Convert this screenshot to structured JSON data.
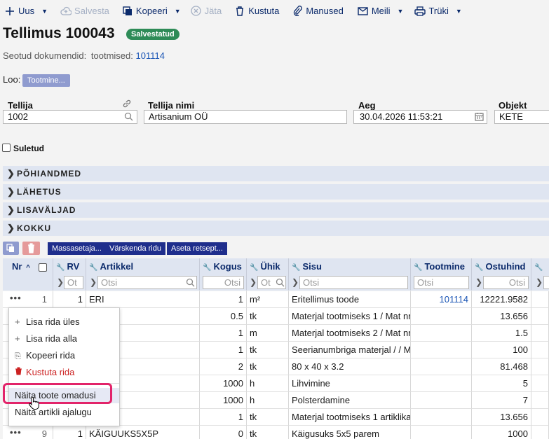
{
  "toolbar": {
    "new": "Uus",
    "save": "Salvesta",
    "copy": "Kopeeri",
    "skip": "Jäta",
    "delete": "Kustuta",
    "attachments": "Manused",
    "email": "Meili",
    "print": "Trüki"
  },
  "header": {
    "title": "Tellimus 100043",
    "status": "Salvestatud",
    "linked_label": "Seotud dokumendid:",
    "linked_type": "tootmised:",
    "linked_id": "101114",
    "loo_label": "Loo:",
    "loo_button": "Tootmine..."
  },
  "fields": {
    "customer_label": "Tellija",
    "customer_value": "1002",
    "name_label": "Tellija nimi",
    "name_value": "Artisanium OÜ",
    "time_label": "Aeg",
    "time_value": "30.04.2026 11:53:21",
    "object_label": "Objekt",
    "object_value": "KETE"
  },
  "closed_label": "Suletud",
  "sections": [
    "PÕHIANDMED",
    "LÄHETUS",
    "LISAVÄLJAD",
    "KOKKU"
  ],
  "row_buttons": [
    "Massasetaja...",
    "Värskenda ridu",
    "Aseta retsept..."
  ],
  "columns": {
    "nr": "Nr",
    "rv": "RV",
    "artikkel": "Artikkel",
    "kogus": "Kogus",
    "uhik": "Ühik",
    "sisu": "Sisu",
    "tootmine": "Tootmine",
    "ostuhind": "Ostuhind"
  },
  "filters": {
    "rv": "Ot",
    "artikkel": "Otsi",
    "kogus": "Otsi",
    "uhik": "Ot",
    "sisu": "Otsi",
    "tootmine": "Otsi",
    "ostuhind": "Otsi"
  },
  "rows": [
    {
      "nr": "1",
      "rv": "1",
      "artikkel": "ERI",
      "kogus": "1",
      "uhik": "m²",
      "sisu": "Eritellimus toode",
      "tootmine": "101114",
      "ostuhind": "12221.9582"
    },
    {
      "nr": "",
      "rv": "",
      "artikkel": "",
      "kogus": "0.5",
      "uhik": "tk",
      "sisu": "Materjal tootmiseks 1 / Mat nr",
      "tootmine": "",
      "ostuhind": "13.656"
    },
    {
      "nr": "",
      "rv": "",
      "artikkel": "",
      "kogus": "1",
      "uhik": "m",
      "sisu": "Materjal tootmiseks 2 / Mat nr",
      "tootmine": "",
      "ostuhind": "1.5"
    },
    {
      "nr": "",
      "rv": "",
      "artikkel": "T",
      "kogus": "1",
      "uhik": "tk",
      "sisu": "Seerianumbriga materjal / / M",
      "tootmine": "",
      "ostuhind": "100"
    },
    {
      "nr": "",
      "rv": "",
      "artikkel": "",
      "kogus": "2",
      "uhik": "tk",
      "sisu": "80 x 40 x 3.2",
      "tootmine": "",
      "ostuhind": "81.468"
    },
    {
      "nr": "",
      "rv": "",
      "artikkel": "",
      "kogus": "1000",
      "uhik": "h",
      "sisu": "Lihvimine",
      "tootmine": "",
      "ostuhind": "5"
    },
    {
      "nr": "",
      "rv": "",
      "artikkel": "",
      "kogus": "1000",
      "uhik": "h",
      "sisu": "Polsterdamine",
      "tootmine": "",
      "ostuhind": "7"
    },
    {
      "nr": "",
      "rv": "",
      "artikkel": "",
      "kogus": "1",
      "uhik": "tk",
      "sisu": "Materjal tootmiseks 1 artiklika",
      "tootmine": "",
      "ostuhind": "13.656"
    },
    {
      "nr": "9",
      "rv": "1",
      "artikkel": "KÄIGUUKS5X5P",
      "kogus": "0",
      "uhik": "tk",
      "sisu": "Käigusuks 5x5 parem",
      "tootmine": "",
      "ostuhind": "1000"
    }
  ],
  "context_menu": {
    "add_above": "Lisa rida üles",
    "add_below": "Lisa rida alla",
    "copy_row": "Kopeeri rida",
    "delete_row": "Kustuta rida",
    "show_properties": "Näita toote omadusi",
    "show_history": "Näita artikli ajalugu"
  },
  "colors": {
    "accent": "#1f2e8c",
    "status": "#2e8b57",
    "highlight": "#e2246a",
    "delete": "#cc2222"
  }
}
